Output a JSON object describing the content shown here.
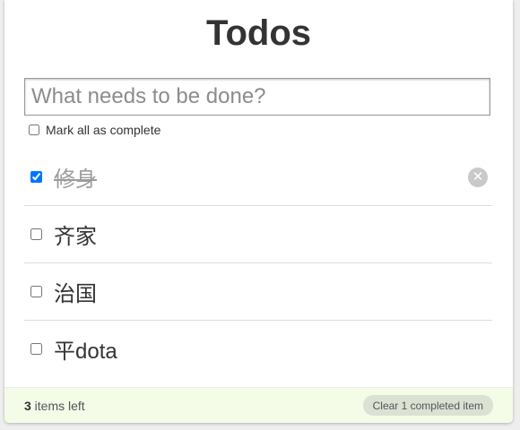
{
  "header": {
    "title": "Todos"
  },
  "new_todo": {
    "placeholder": "What needs to be done?",
    "value": ""
  },
  "toggle_all": {
    "label": "Mark all as complete",
    "checked": false
  },
  "todos": [
    {
      "text": "修身",
      "completed": true
    },
    {
      "text": "齐家",
      "completed": false
    },
    {
      "text": "治国",
      "completed": false
    },
    {
      "text": "平dota",
      "completed": false
    }
  ],
  "footer": {
    "count": "3",
    "count_suffix": " items left",
    "clear_label": "Clear 1 completed item"
  },
  "icons": {
    "destroy": "close-icon"
  },
  "colors": {
    "footer_bg": "#f4fce8",
    "clear_button_bg": "#dbe2d4",
    "completed_text": "#9c9c9c"
  }
}
